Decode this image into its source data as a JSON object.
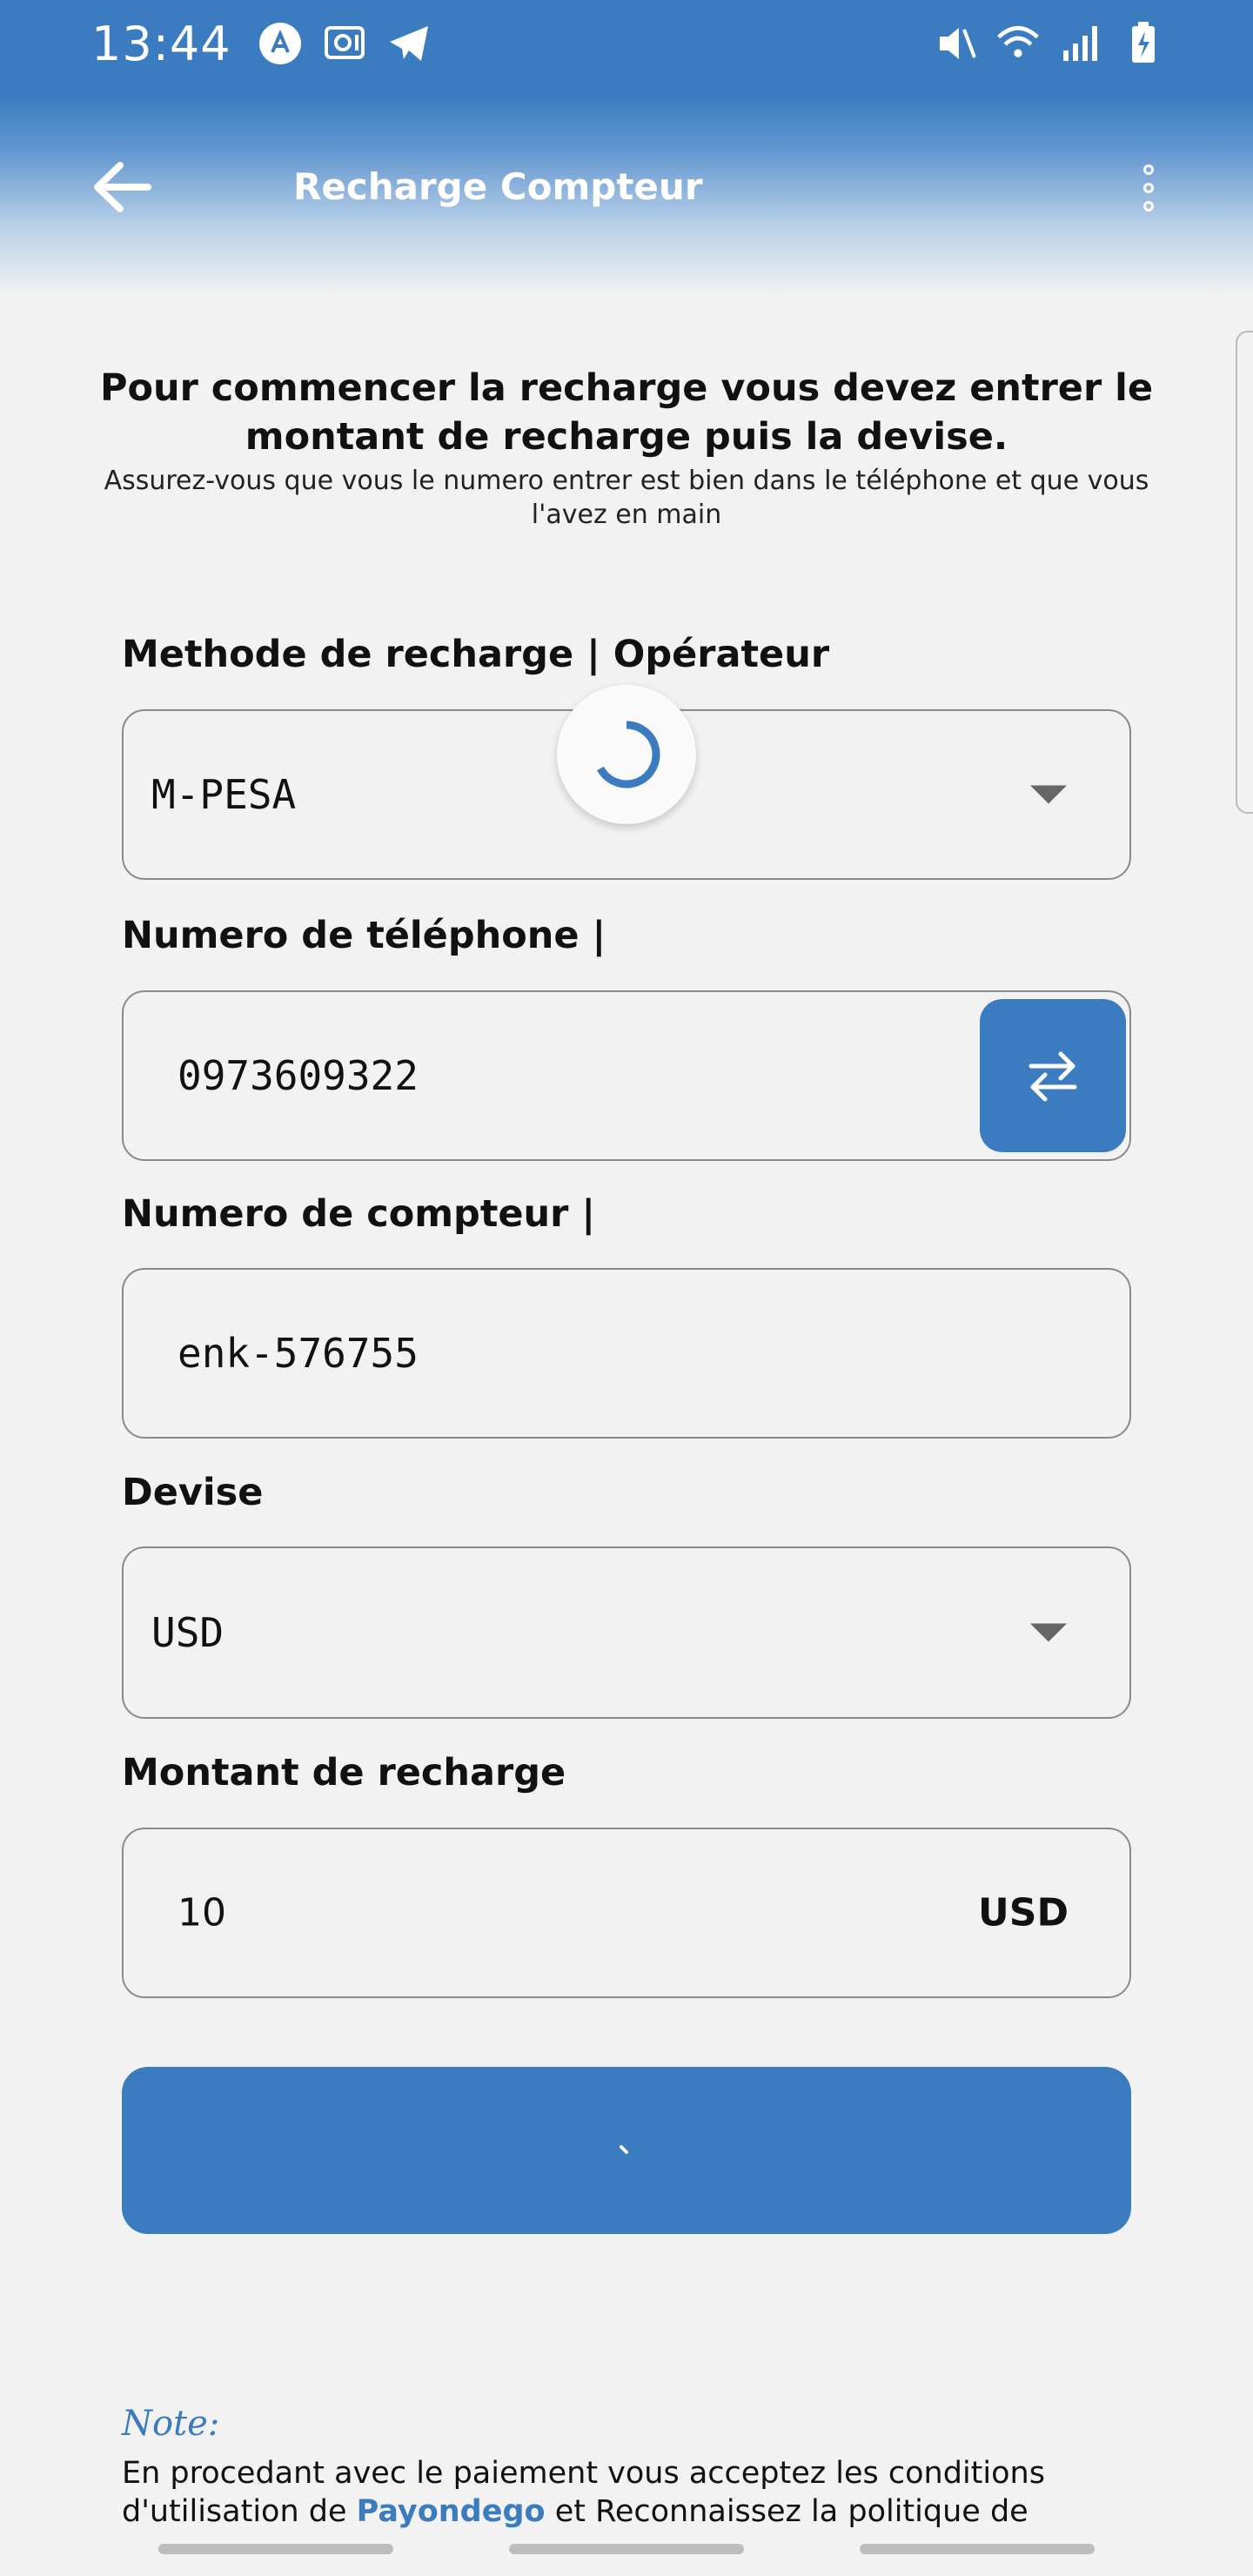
{
  "status_bar": {
    "time": "13:44",
    "left_icons": [
      "a-circle-icon",
      "safe-icon",
      "telegram-icon"
    ],
    "right_icons": [
      "mute-icon",
      "wifi-icon",
      "signal-icon",
      "battery-icon"
    ]
  },
  "appbar": {
    "title": "Recharge Compteur",
    "back_icon": "arrow-left-icon",
    "menu_icon": "more-vertical-icon"
  },
  "intro": {
    "title": "Pour commencer la recharge vous devez entrer le montant de recharge puis la devise.",
    "subtitle": "Assurez-vous que vous le numero entrer est bien dans le téléphone et que vous l'avez en main"
  },
  "form": {
    "method": {
      "label": "Methode de recharge | Opérateur",
      "value": "M-PESA"
    },
    "phone": {
      "label": "Numero de téléphone |",
      "value": "0973609322",
      "swap_icon": "swap-arrows-icon"
    },
    "meter": {
      "label": "Numero de compteur |",
      "value": "enk-576755"
    },
    "currency": {
      "label": "Devise",
      "value": "USD"
    },
    "amount": {
      "label": "Montant de recharge",
      "value": "10",
      "suffix": "USD"
    }
  },
  "note": {
    "title": "Note:",
    "text_before": "En procedant avec le paiement vous acceptez les conditions d'utilisation de ",
    "link": "Payondego",
    "text_after": " et Reconnaissez la politique de"
  },
  "colors": {
    "primary": "#3b7cc1",
    "background": "#f2f2f2"
  }
}
